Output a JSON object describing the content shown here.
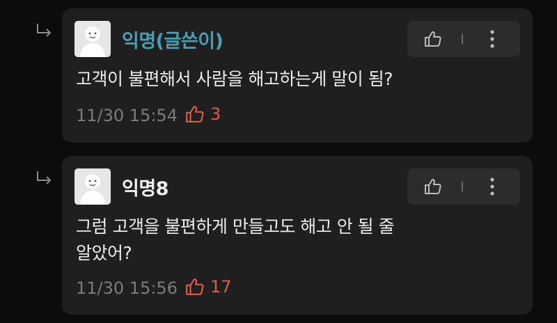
{
  "comments": [
    {
      "author": "익명(글쓴이)",
      "author_color": "#46a0b4",
      "is_op": true,
      "lines": [
        "고객이 불편해서 사람을 해고하는게 말이 됨?"
      ],
      "date": "11/30 15:54",
      "likes": "3",
      "icons": [
        "reply-arrow-icon",
        "avatar-icon",
        "thumbs-up-icon",
        "more-vertical-icon"
      ]
    },
    {
      "author": "익명8",
      "author_color": "#f2f2f2",
      "is_op": false,
      "lines": [
        "그럼 고객을 불편하게 만들고도 해고 안 될 줄",
        "알았어?"
      ],
      "date": "11/30 15:56",
      "likes": "17",
      "icons": [
        "reply-arrow-icon",
        "avatar-icon",
        "thumbs-up-icon",
        "more-vertical-icon"
      ]
    }
  ],
  "colors": {
    "background": "#0c0c0c",
    "card": "#1f1f1f",
    "action_bar": "#2c2c2c",
    "like_accent": "#e05c40",
    "meta_text": "#7c7c7c"
  }
}
